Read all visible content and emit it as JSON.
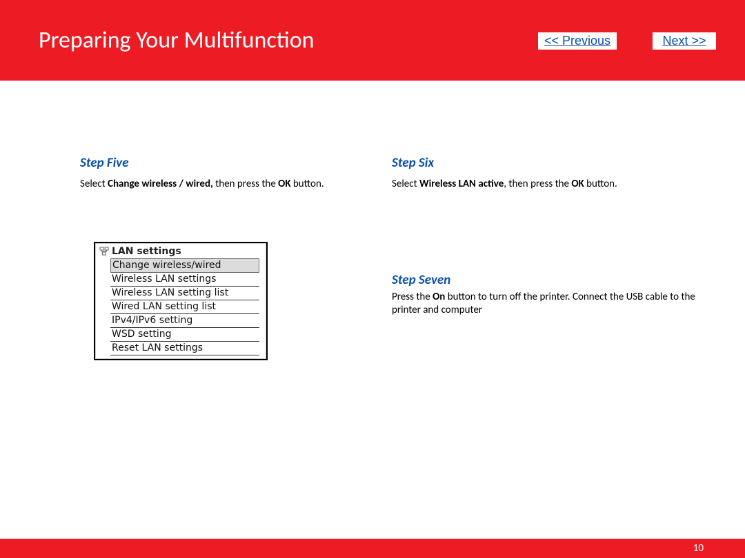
{
  "header": {
    "title": "Preparing Your Multifunction",
    "prev": " << Previous",
    "next": "Next >>"
  },
  "steps": {
    "five": {
      "heading": "Step Five",
      "text_pre": "Select ",
      "bold1": "Change wireless / wired,",
      "text_mid": " then press the ",
      "bold2": "OK",
      "text_post": " button."
    },
    "six": {
      "heading": "Step Six",
      "text_pre": "Select ",
      "bold1": "Wireless LAN active",
      "text_mid": ", then press the ",
      "bold2": "OK",
      "text_post": " button."
    },
    "seven": {
      "heading": "Step Seven",
      "text_pre": "Press the ",
      "bold1": "On",
      "text_post": " button to turn off the printer. Connect the USB cable to the printer and computer"
    }
  },
  "lan": {
    "title": "LAN settings",
    "items": [
      "Change wireless/wired",
      "Wireless LAN settings",
      "Wireless LAN setting list",
      "Wired LAN setting list",
      "IPv4/IPv6 setting",
      "WSD setting",
      "Reset LAN settings"
    ]
  },
  "footer": {
    "page": "10"
  }
}
